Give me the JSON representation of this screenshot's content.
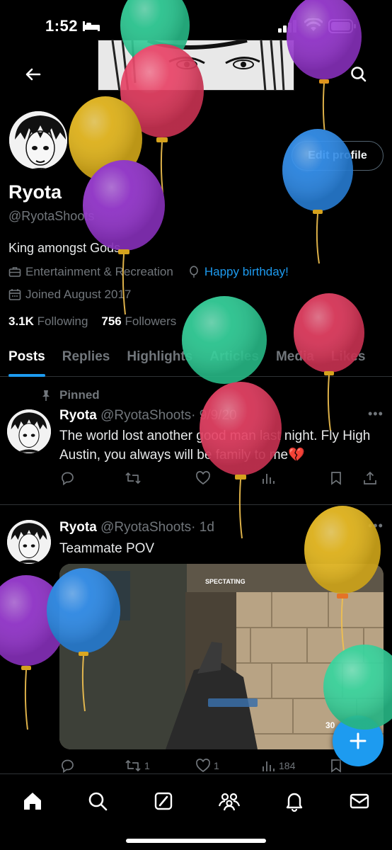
{
  "status_bar": {
    "time": "1:52"
  },
  "profile": {
    "display_name": "Ryota",
    "handle": "@RyotaShoots",
    "bio": "King amongst Gods",
    "category": "Entertainment & Recreation",
    "birthday": "Happy birthday!",
    "joined": "Joined August 2017",
    "following_count": "3.1K",
    "following_label": "Following",
    "followers_count": "756",
    "followers_label": "Followers",
    "edit_profile_label": "Edit profile"
  },
  "tabs": [
    "Posts",
    "Replies",
    "Highlights",
    "Articles",
    "Media",
    "Likes"
  ],
  "posts": [
    {
      "pinned_label": "Pinned",
      "name": "Ryota",
      "handle": "@RyotaShoots",
      "time": "· 9/9/20",
      "text": "The world lost another good man last night. Fly High Austin, you always will be family to me💔",
      "replies": "",
      "reposts": "",
      "likes": "",
      "views": ""
    },
    {
      "name": "Ryota",
      "handle": "@RyotaShoots",
      "time": "· 1d",
      "text": "Teammate POV",
      "media_overlay": "SPECTATING",
      "ammo": "30",
      "replies": "",
      "reposts": "1",
      "likes": "1",
      "views": "184"
    }
  ],
  "colors": {
    "accent": "#1d9bf0",
    "muted": "#71767b",
    "background": "#000000",
    "balloon_green": "#2ed39a",
    "balloon_red": "#e83a5f",
    "balloon_purple": "#9b37d6",
    "balloon_yellow": "#f0c01e",
    "balloon_blue": "#2d8ef0"
  },
  "icons": {
    "back": "arrow-left-icon",
    "search": "search-icon",
    "category": "briefcase-icon",
    "birthday": "balloon-icon",
    "joined": "calendar-icon",
    "pin": "pin-icon",
    "nav": [
      "home-icon",
      "search-icon",
      "grok-icon",
      "communities-icon",
      "bell-icon",
      "mail-icon"
    ],
    "fab": "plus-icon"
  }
}
